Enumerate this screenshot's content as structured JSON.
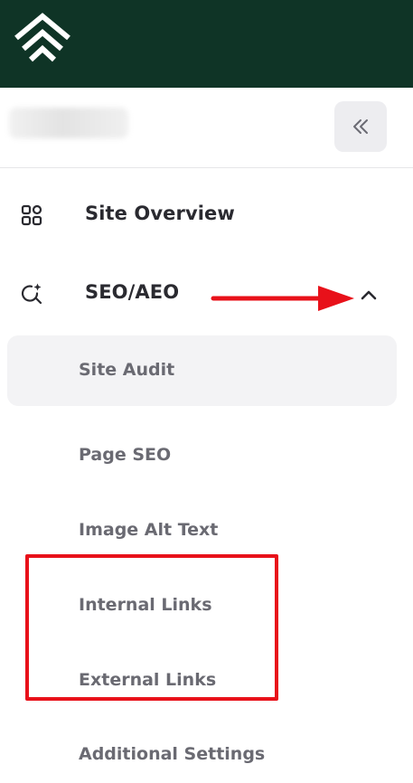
{
  "app": {
    "logo_icon": "brand-logo-chevrons"
  },
  "account": {
    "name_blurred": true
  },
  "nav": {
    "collapse_icon": "double-chevron-left-icon",
    "items": [
      {
        "label": "Site Overview",
        "icon": "grid-icon"
      },
      {
        "label": "SEO/AEO",
        "icon": "search-sparkle-icon",
        "expanded": true
      }
    ],
    "seo_submenu": [
      {
        "label": "Site Audit",
        "active": true
      },
      {
        "label": "Page SEO"
      },
      {
        "label": "Image Alt Text"
      },
      {
        "label": "Internal Links"
      },
      {
        "label": "External Links"
      },
      {
        "label": "Additional Settings"
      }
    ]
  },
  "annotation": {
    "arrow_color": "#e8111a",
    "box_color": "#e8111a"
  },
  "colors": {
    "header_bg": "#0f3426",
    "active_bg": "#f3f3f5",
    "text_primary": "#2a2a30",
    "text_secondary": "#6a6a72"
  }
}
